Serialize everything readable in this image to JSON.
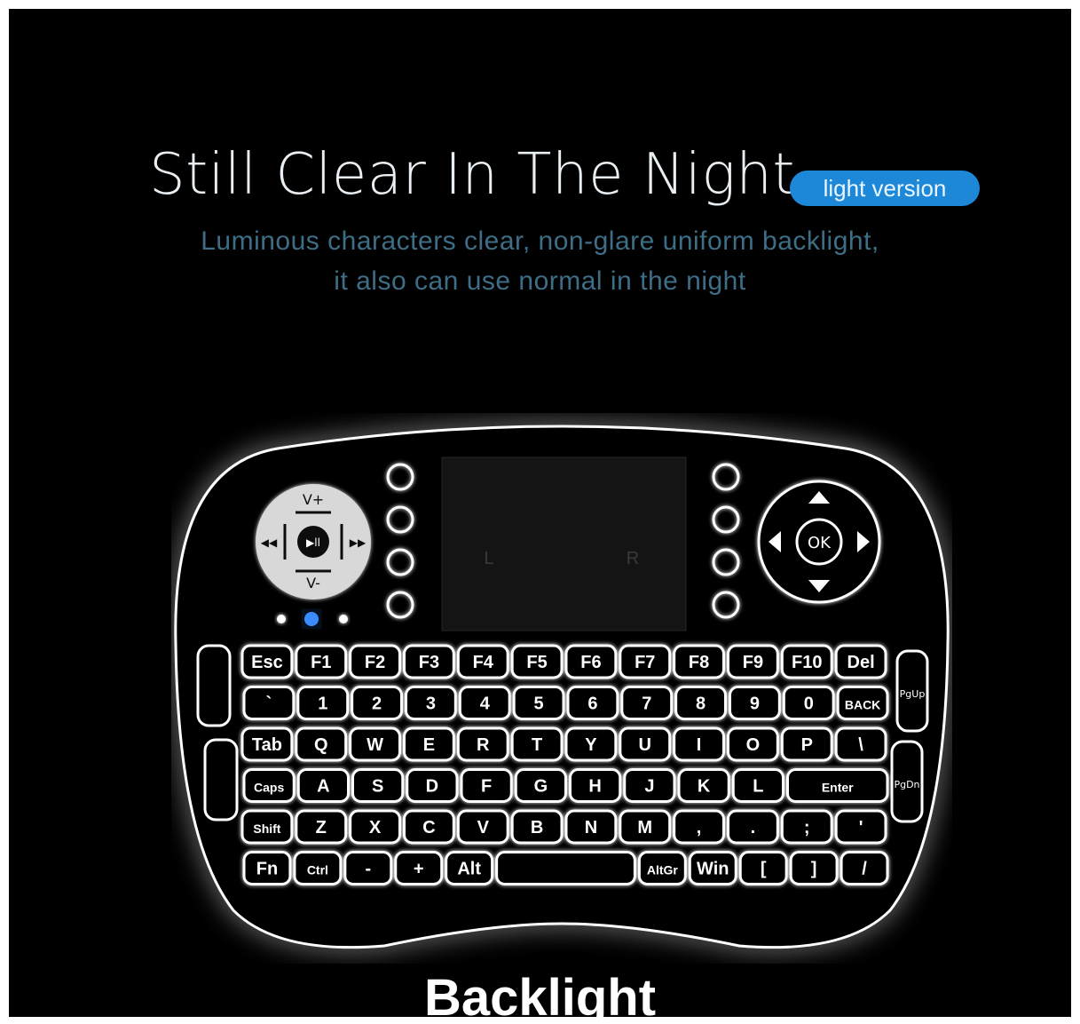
{
  "headline": "Still Clear In The Night",
  "badge": "light version",
  "subtitle_line1": "Luminous characters clear, non-glare uniform backlight,",
  "subtitle_line2": "it also can use normal in the night",
  "caption": "Backlight",
  "colors": {
    "background": "#000000",
    "badge": "#1e88d8",
    "subtitle": "#3e6d86",
    "key_glow": "#ffffff"
  },
  "keyboard": {
    "rows": [
      [
        "Esc",
        "F1",
        "F2",
        "F3",
        "F4",
        "F5",
        "F6",
        "F7",
        "F8",
        "F9",
        "F10",
        "Del"
      ],
      [
        "`",
        "1",
        "2",
        "3",
        "4",
        "5",
        "6",
        "7",
        "8",
        "9",
        "0",
        "BACK"
      ],
      [
        "Tab",
        "Q",
        "W",
        "E",
        "R",
        "T",
        "Y",
        "U",
        "I",
        "O",
        "P",
        "\\"
      ],
      [
        "Caps",
        "A",
        "S",
        "D",
        "F",
        "G",
        "H",
        "J",
        "K",
        "L",
        "Enter"
      ],
      [
        "Shift",
        "Z",
        "X",
        "C",
        "V",
        "B",
        "N",
        "M",
        ",",
        ".",
        ";",
        "'"
      ],
      [
        "Fn",
        "Ctrl",
        "-",
        "+",
        "Alt",
        "",
        "AltGr",
        "Win",
        "[",
        "]",
        "/"
      ]
    ],
    "side_keys_right": [
      "PgUp",
      "PgDn"
    ],
    "dpad_left": {
      "up": "V+",
      "down": "V-"
    },
    "dpad_right": {
      "center": "OK"
    },
    "touchpad_labels": [
      "L",
      "R"
    ]
  }
}
